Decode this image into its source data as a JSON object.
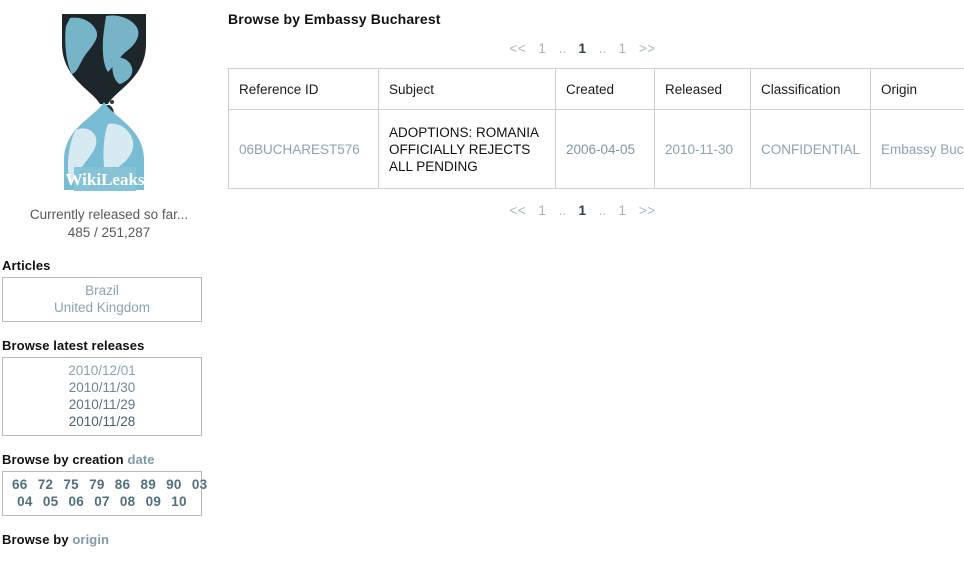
{
  "site": {
    "logo_alt": "WikiLeaks",
    "logo_wordmark": "WikiLeaks",
    "released_label": "Currently released so far...",
    "released_count": "485 / 251,287"
  },
  "sidebar": {
    "sections": [
      {
        "heading": "Articles",
        "heading_link": "",
        "items": [
          {
            "label": "Brazil"
          },
          {
            "label": "United Kingdom"
          }
        ]
      },
      {
        "heading": "Browse latest releases",
        "heading_link": "",
        "items": [
          {
            "label": "2010/12/01"
          },
          {
            "label": "2010/11/30"
          },
          {
            "label": "2010/11/29"
          },
          {
            "label": "2010/11/28"
          }
        ]
      },
      {
        "heading": "Browse by creation",
        "heading_link": "date",
        "rows": [
          [
            "66",
            "72",
            "75",
            "79",
            "86",
            "89",
            "90",
            "03"
          ],
          [
            "04",
            "05",
            "06",
            "07",
            "08",
            "09",
            "10"
          ]
        ]
      },
      {
        "heading": "Browse by",
        "heading_link": "origin"
      }
    ]
  },
  "main": {
    "title": "Browse by Embassy Bucharest",
    "pager": {
      "first": "<<",
      "prev_page": "1",
      "gap_left": "..",
      "current": "1",
      "gap_right": "..",
      "next_page": "1",
      "last": ">>"
    },
    "table": {
      "columns": [
        "Reference ID",
        "Subject",
        "Created",
        "Released",
        "Classification",
        "Origin"
      ],
      "rows": [
        {
          "reference_id": "06BUCHAREST576",
          "subject": "ADOPTIONS: ROMANIA OFFICIALLY REJECTS ALL PENDING",
          "created": "2006-04-05",
          "released": "2010-11-30",
          "classification": "CONFIDENTIAL",
          "origin": "Embassy Bucharest"
        }
      ]
    }
  },
  "colors": {
    "link": "#8aa4b2",
    "link_strong": "#50707f",
    "text": "#222222",
    "border": "#cfcfcf",
    "logo_dark": "#1b2327",
    "logo_light": "#79bdd4"
  }
}
